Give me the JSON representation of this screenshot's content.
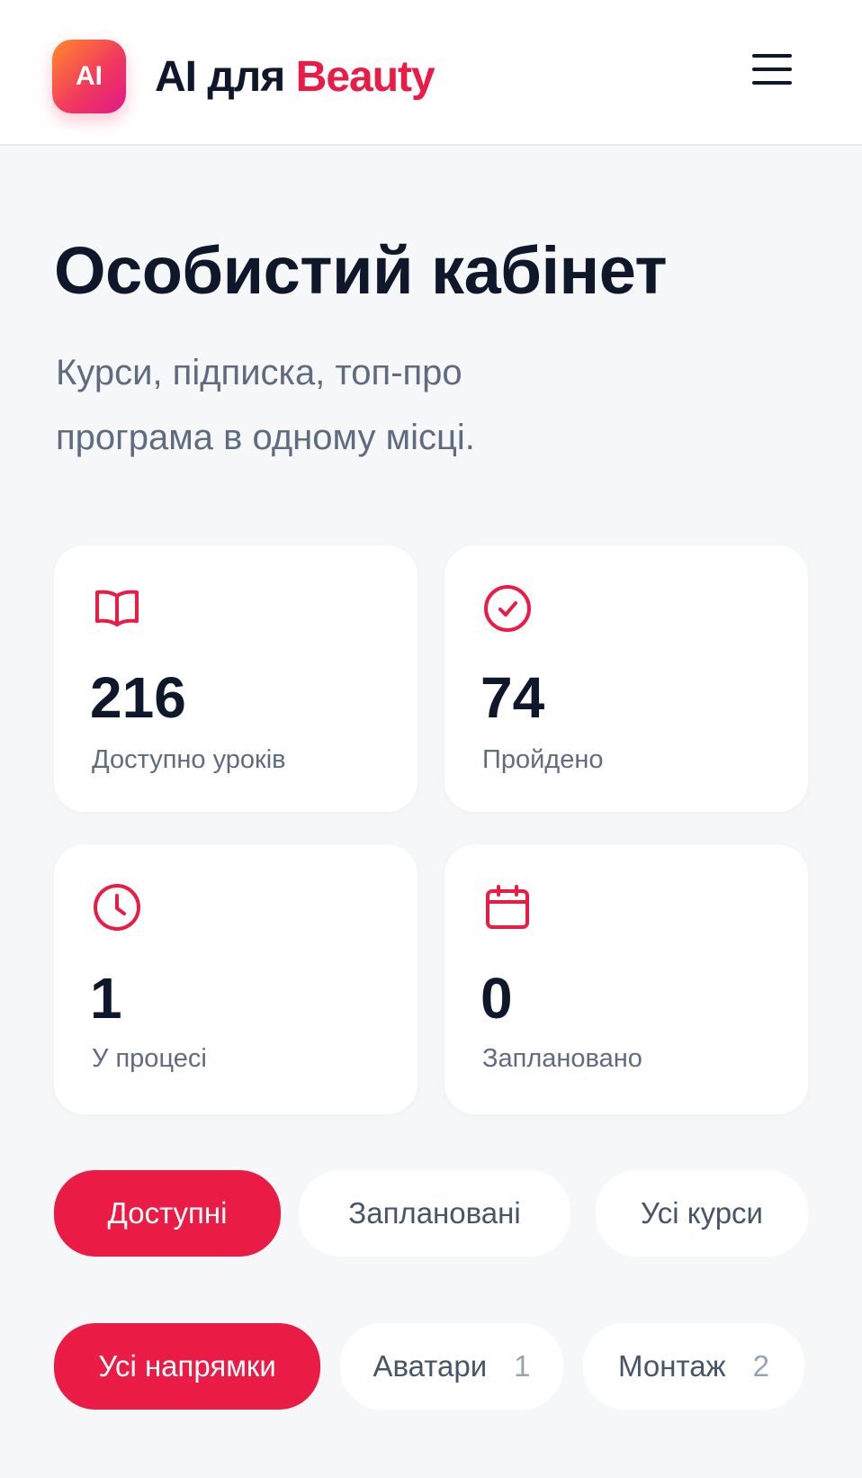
{
  "header": {
    "logo_text": "AI",
    "brand_prefix": "AI для",
    "brand_accent": "Beauty",
    "menu_icon": "hamburger-menu-icon"
  },
  "page": {
    "title": "Особистий кабінет",
    "subtitle_line1": "Курси, підписка, топ-про",
    "subtitle_line2": "програма в одному місці."
  },
  "stats": [
    {
      "icon": "book-open-icon",
      "value": "216",
      "label": "Доступно уроків"
    },
    {
      "icon": "check-circle-icon",
      "value": "74",
      "label": "Пройдено"
    },
    {
      "icon": "clock-icon",
      "value": "1",
      "label": "У процесі"
    },
    {
      "icon": "calendar-icon",
      "value": "0",
      "label": "Заплановано"
    }
  ],
  "tabs": [
    {
      "label": "Доступні",
      "active": true
    },
    {
      "label": "Заплановані",
      "active": false
    },
    {
      "label": "Усі курси",
      "active": false
    }
  ],
  "filters": [
    {
      "label": "Усі напрямки",
      "active": true
    },
    {
      "label": "Аватари",
      "count": "1",
      "active": false
    },
    {
      "label": "Монтаж",
      "count": "2",
      "active": false
    }
  ],
  "colors": {
    "accent": "#ea1b45",
    "background": "#f6f7f9",
    "text_primary": "#0f172a",
    "text_secondary": "#5f6b7f"
  }
}
